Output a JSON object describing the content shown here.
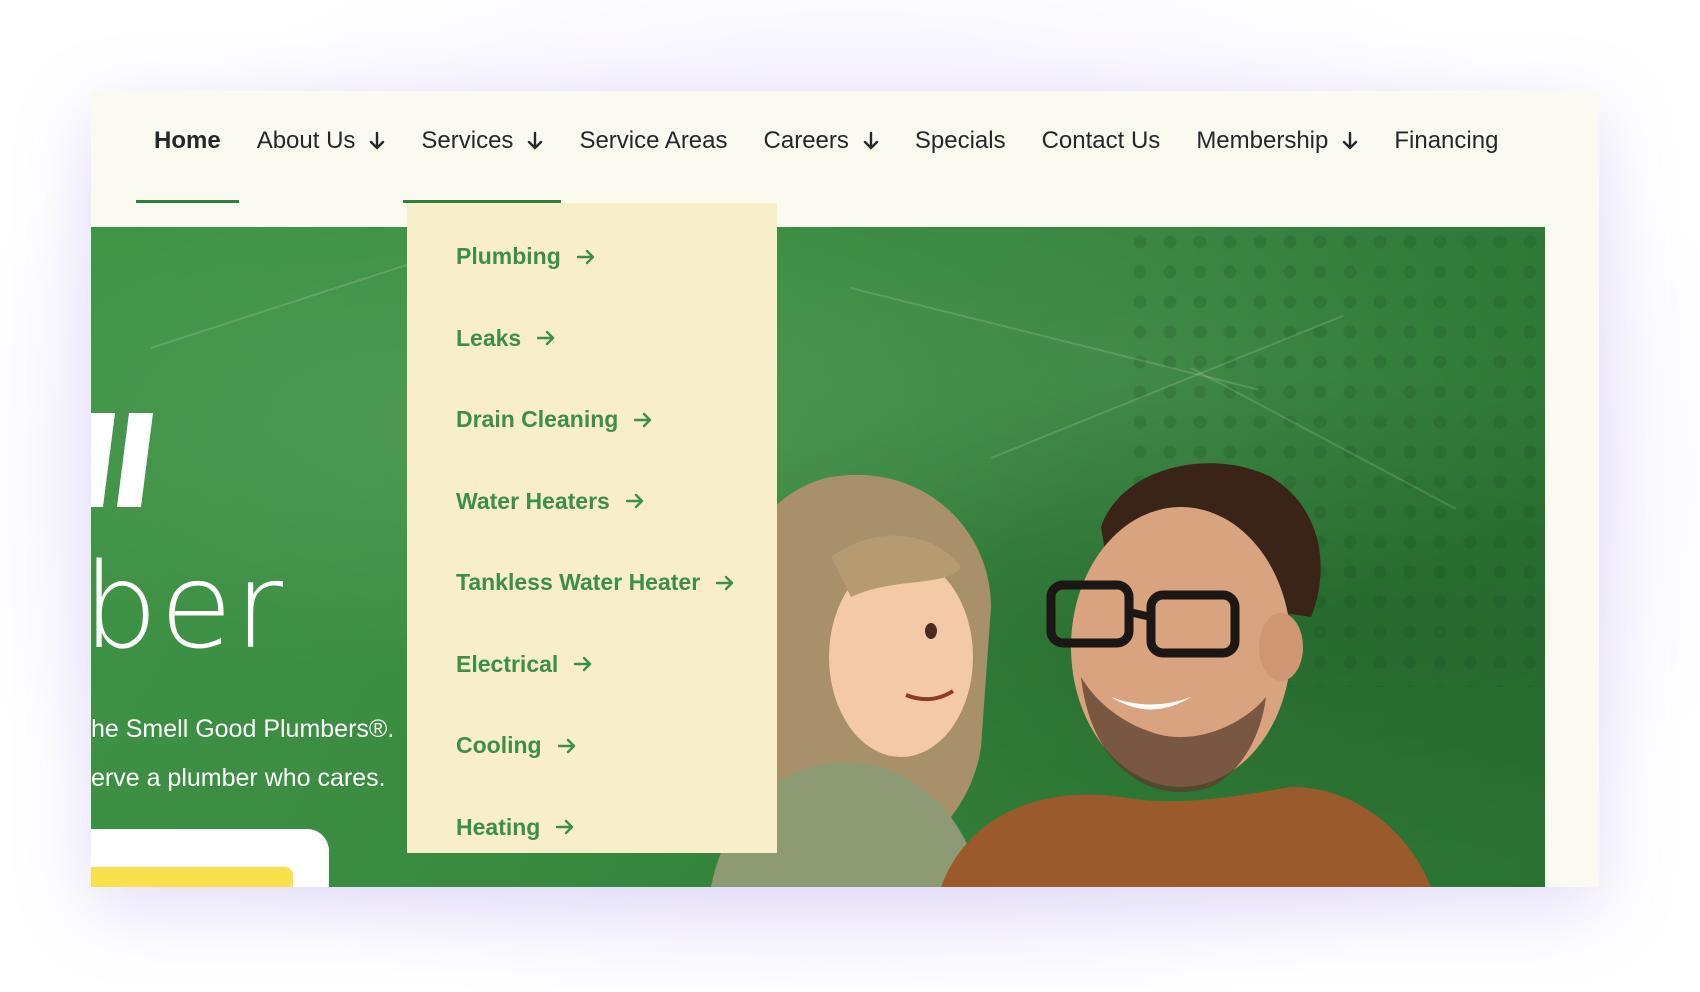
{
  "nav": {
    "items": [
      {
        "label": "Home",
        "has_dropdown": false,
        "active": true
      },
      {
        "label": "About Us",
        "has_dropdown": true,
        "active": false
      },
      {
        "label": "Services",
        "has_dropdown": true,
        "active": false,
        "open": true
      },
      {
        "label": "Service Areas",
        "has_dropdown": false,
        "active": false
      },
      {
        "label": "Careers",
        "has_dropdown": true,
        "active": false
      },
      {
        "label": "Specials",
        "has_dropdown": false,
        "active": false
      },
      {
        "label": "Contact Us",
        "has_dropdown": false,
        "active": false
      },
      {
        "label": "Membership",
        "has_dropdown": true,
        "active": false
      },
      {
        "label": "Financing",
        "has_dropdown": false,
        "active": false
      }
    ]
  },
  "services_menu": {
    "items": [
      {
        "label": "Plumbing"
      },
      {
        "label": "Leaks"
      },
      {
        "label": "Drain Cleaning"
      },
      {
        "label": "Water Heaters"
      },
      {
        "label": "Tankless Water Heater"
      },
      {
        "label": "Electrical"
      },
      {
        "label": "Cooling"
      },
      {
        "label": "Heating"
      }
    ]
  },
  "hero": {
    "heading_partial": "ber",
    "line1": "he Smell Good Plumbers®.",
    "line2": "erve a plumber who cares."
  },
  "colors": {
    "accent_green": "#2f7d3f",
    "menu_text_green": "#3d8e47",
    "menu_background": "#f8efca",
    "hero_green": "#3a8b40",
    "cta_yellow": "#f8e14a",
    "nav_text": "#23282b"
  },
  "icons": {
    "nav_dropdown": "arrow-down-icon",
    "menu_item": "arrow-right-icon"
  }
}
